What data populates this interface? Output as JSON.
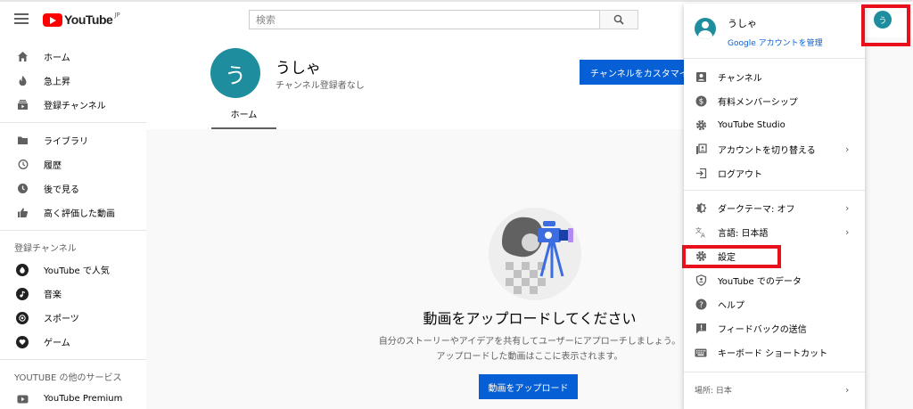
{
  "header": {
    "logo_text": "YouTube",
    "logo_region": "JP",
    "search_placeholder": "検索",
    "avatar_letter": "う"
  },
  "sidebar": {
    "main_items": [
      {
        "label": "ホーム",
        "icon": "home-icon"
      },
      {
        "label": "急上昇",
        "icon": "flame-icon"
      },
      {
        "label": "登録チャンネル",
        "icon": "subscriptions-icon"
      }
    ],
    "library_items": [
      {
        "label": "ライブラリ",
        "icon": "folder-icon"
      },
      {
        "label": "履歴",
        "icon": "history-icon"
      },
      {
        "label": "後で見る",
        "icon": "clock-icon"
      },
      {
        "label": "高く評価した動画",
        "icon": "thumbs-up-icon"
      }
    ],
    "subscriptions_heading": "登録チャンネル",
    "subscription_items": [
      {
        "label": "YouTube で人気",
        "icon": "popular-icon"
      },
      {
        "label": "音楽",
        "icon": "music-icon"
      },
      {
        "label": "スポーツ",
        "icon": "sports-icon"
      },
      {
        "label": "ゲーム",
        "icon": "gaming-icon"
      }
    ],
    "more_heading": "YOUTUBE の他のサービス",
    "more_items": [
      {
        "label": "YouTube Premium",
        "icon": "youtube-premium-icon"
      }
    ]
  },
  "channel": {
    "avatar_letter": "う",
    "name": "うしゃ",
    "subscribers": "チャンネル登録者なし",
    "customize_label": "チャンネルをカスタマイズ",
    "tab_home": "ホーム"
  },
  "empty_state": {
    "title": "動画をアップロードしてください",
    "desc_line1": "自分のストーリーやアイデアを共有してユーザーにアプローチしましょう。",
    "desc_line2": "アップロードした動画はここに表示されます。",
    "upload_label": "動画をアップロード"
  },
  "account_menu": {
    "name": "うしゃ",
    "manage_label": "Google アカウントを管理",
    "group1": [
      {
        "label": "チャンネル",
        "icon": "person-icon"
      },
      {
        "label": "有料メンバーシップ",
        "icon": "dollar-icon"
      },
      {
        "label": "YouTube Studio",
        "icon": "gear-icon"
      },
      {
        "label": "アカウントを切り替える",
        "icon": "switch-account-icon"
      },
      {
        "label": "ログアウト",
        "icon": "logout-icon"
      }
    ],
    "group2": [
      {
        "label": "ダークテーマ: オフ",
        "icon": "dark-theme-icon"
      },
      {
        "label": "言語: 日本語",
        "icon": "translate-icon"
      },
      {
        "label": "設定",
        "icon": "settings-icon"
      },
      {
        "label": "YouTube でのデータ",
        "icon": "shield-icon"
      },
      {
        "label": "ヘルプ",
        "icon": "help-icon"
      },
      {
        "label": "フィードバックの送信",
        "icon": "feedback-icon"
      },
      {
        "label": "キーボード ショートカット",
        "icon": "keyboard-icon"
      }
    ],
    "location": "場所: 日本"
  },
  "colors": {
    "accent": "#065fd4",
    "avatar": "#1e8e9e",
    "annotation": "#e8101b"
  }
}
